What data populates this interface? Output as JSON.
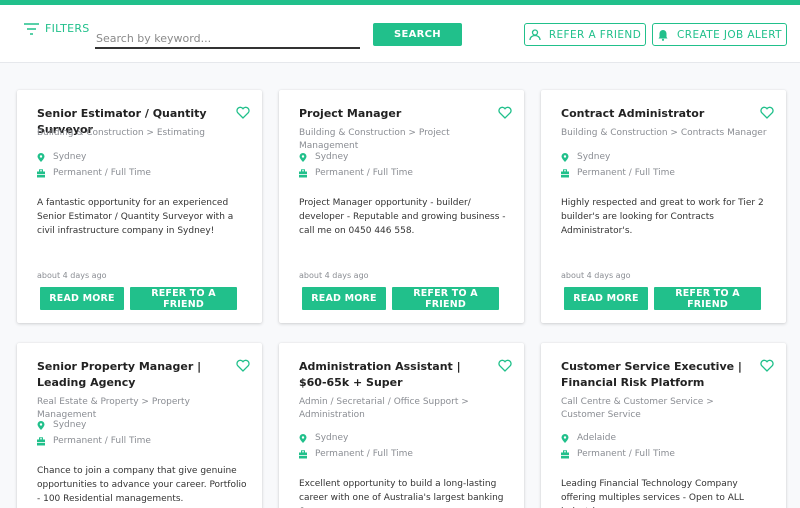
{
  "header": {
    "filters_label": "FILTERS",
    "search_placeholder": "Search by keyword...",
    "search_button": "SEARCH",
    "refer_friend_button": "REFER A FRIEND",
    "create_alert_button": "CREATE JOB ALERT"
  },
  "colors": {
    "accent": "#21c08b"
  },
  "jobs": [
    {
      "title": "Senior Estimator / Quantity Surveyor",
      "category": "Building & Construction > Estimating",
      "location": "Sydney",
      "work_type": "Permanent / Full Time",
      "description": "A fantastic opportunity for an experienced Senior Estimator / Quantity Surveyor with a civil infrastructure company in Sydney!",
      "posted": "about 4 days ago",
      "read_more": "READ MORE",
      "refer": "REFER TO A FRIEND"
    },
    {
      "title": "Project Manager",
      "category": "Building & Construction > Project Management",
      "location": "Sydney",
      "work_type": "Permanent / Full Time",
      "description": "Project Manager opportunity - builder/ developer - Reputable and growing business - call me on 0450 446 558.",
      "posted": "about 4 days ago",
      "read_more": "READ MORE",
      "refer": "REFER TO A FRIEND"
    },
    {
      "title": "Contract Administrator",
      "category": "Building & Construction > Contracts Manager",
      "location": "Sydney",
      "work_type": "Permanent / Full Time",
      "description": "Highly respected and great to work for Tier 2 builder's are looking for Contracts Administrator's.",
      "posted": "about 4 days ago",
      "read_more": "READ MORE",
      "refer": "REFER TO A FRIEND"
    },
    {
      "title": "Senior Property Manager | Leading Agency",
      "category": "Real Estate & Property > Property Management",
      "location": "Sydney",
      "work_type": "Permanent / Full Time",
      "description": "Chance to join a company that give genuine opportunities to advance your career. Portfolio - 100 Residential managements."
    },
    {
      "title": "Administration Assistant | $60-65k + Super",
      "category": "Admin / Secretarial / Office Support > Administration",
      "location": "Sydney",
      "work_type": "Permanent / Full Time",
      "description": "Excellent opportunity to build a long-lasting career with one of Australia's largest banking &"
    },
    {
      "title": "Customer Service Executive | Financial Risk Platform",
      "category": "Call Centre & Customer Service > Customer Service",
      "location": "Adelaide",
      "work_type": "Permanent / Full Time",
      "description": "Leading Financial Technology Company offering multiples services - Open to ALL industries"
    }
  ]
}
